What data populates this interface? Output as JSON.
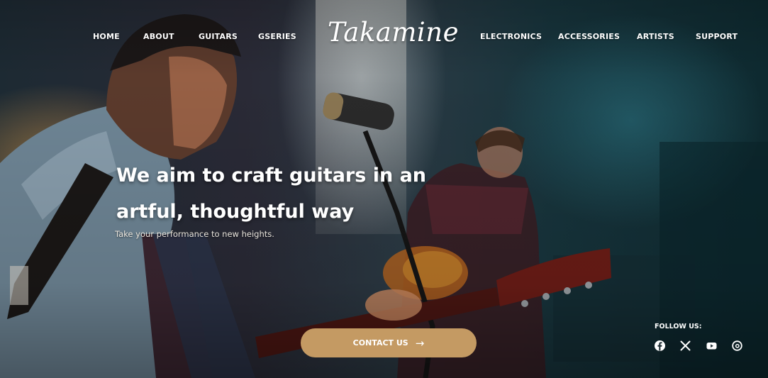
{
  "nav": {
    "left_items": [
      {
        "label": "HOME"
      },
      {
        "label": "ABOUT"
      },
      {
        "label": "GUITARS"
      },
      {
        "label": "GSERIES"
      }
    ],
    "right_items": [
      {
        "label": "ELECTRONICS"
      },
      {
        "label": "ACCESSORIES"
      },
      {
        "label": "ARTISTS"
      },
      {
        "label": "SUPPORT"
      }
    ]
  },
  "logo": {
    "text": "Takamine"
  },
  "hero": {
    "headline_line1": "We aim to craft guitars in an",
    "headline_line2": "artful, thoughtful way",
    "subtext": "Take your performance to new heights.",
    "cta_label": "CONTACT US",
    "cta_arrow": "→"
  },
  "social": {
    "heading": "FOLLOW US:",
    "icons": [
      "facebook-icon",
      "x-icon",
      "youtube-icon",
      "threads-icon"
    ]
  },
  "colors": {
    "cta_background": "#c49a63",
    "nav_text": "#ffffff"
  }
}
